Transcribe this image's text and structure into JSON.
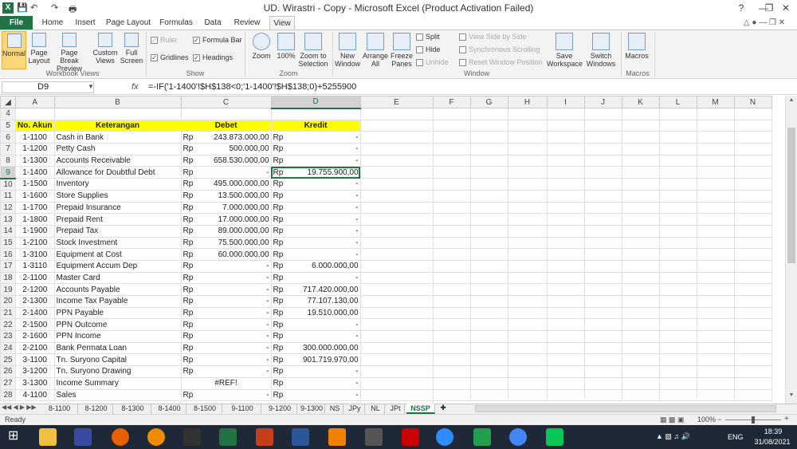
{
  "window": {
    "title": "UD. Wirastri - Copy  -  Microsoft Excel (Product Activation Failed)"
  },
  "tabs": [
    "File",
    "Home",
    "Insert",
    "Page Layout",
    "Formulas",
    "Data",
    "Review",
    "View"
  ],
  "ribbon": {
    "views": {
      "normal": "Normal",
      "page_layout": "Page Layout",
      "page_break": "Page Break Preview",
      "custom": "Custom Views",
      "full": "Full Screen",
      "label": "Workbook Views"
    },
    "show": {
      "ruler": "Ruler",
      "formula_bar": "Formula Bar",
      "gridlines": "Gridlines",
      "headings": "Headings",
      "label": "Show"
    },
    "zoom": {
      "zoom": "Zoom",
      "z100": "100%",
      "selection": "Zoom to Selection",
      "label": "Zoom"
    },
    "window": {
      "new": "New Window",
      "arrange": "Arrange All",
      "freeze": "Freeze Panes",
      "split": "Split",
      "hide": "Hide",
      "unhide": "Unhide",
      "side": "View Side by Side",
      "sync": "Synchronous Scrolling",
      "reset": "Reset Window Position",
      "save": "Save Workspace",
      "switch": "Switch Windows",
      "label": "Window"
    },
    "macros": {
      "macros": "Macros",
      "label": "Macros"
    }
  },
  "formula_bar": {
    "name_box": "D9",
    "fx": "fx",
    "formula": "=-IF('1-1400'!$H$138<0;'1-1400'!$H$138;0)+5255900"
  },
  "columns": [
    "A",
    "B",
    "C",
    "D",
    "E",
    "F",
    "G",
    "H",
    "I",
    "J",
    "K",
    "L",
    "M",
    "N"
  ],
  "header_row": {
    "num": "5",
    "a": "No. Akun",
    "b": "Keterangan",
    "c": "Debet",
    "d": "Kredit"
  },
  "rows": [
    {
      "n": "6",
      "a": "1-1100",
      "b": "Cash in Bank",
      "cc": "Rp",
      "c": "243.873.000,00",
      "dc": "Rp",
      "d": "-"
    },
    {
      "n": "7",
      "a": "1-1200",
      "b": "Petty Cash",
      "cc": "Rp",
      "c": "500.000,00",
      "dc": "Rp",
      "d": "-"
    },
    {
      "n": "8",
      "a": "1-1300",
      "b": "Accounts Receivable",
      "cc": "Rp",
      "c": "658.530.000,00",
      "dc": "Rp",
      "d": "-"
    },
    {
      "n": "9",
      "a": "1-1400",
      "b": "Allowance for Doubtful Debt",
      "cc": "Rp",
      "c": "-",
      "dc": "Rp",
      "d": "19.755.900,00"
    },
    {
      "n": "10",
      "a": "1-1500",
      "b": "Inventory",
      "cc": "Rp",
      "c": "495.000.000,00",
      "dc": "Rp",
      "d": "-"
    },
    {
      "n": "11",
      "a": "1-1600",
      "b": "Store Supplies",
      "cc": "Rp",
      "c": "13.500.000,00",
      "dc": "Rp",
      "d": "-"
    },
    {
      "n": "12",
      "a": "1-1700",
      "b": "Prepaid Insurance",
      "cc": "Rp",
      "c": "7.000.000,00",
      "dc": "Rp",
      "d": "-"
    },
    {
      "n": "13",
      "a": "1-1800",
      "b": "Prepaid Rent",
      "cc": "Rp",
      "c": "17.000.000,00",
      "dc": "Rp",
      "d": "-"
    },
    {
      "n": "14",
      "a": "1-1900",
      "b": "Prepaid Tax",
      "cc": "Rp",
      "c": "89.000.000,00",
      "dc": "Rp",
      "d": "-"
    },
    {
      "n": "15",
      "a": "1-2100",
      "b": "Stock Investment",
      "cc": "Rp",
      "c": "75.500.000,00",
      "dc": "Rp",
      "d": "-"
    },
    {
      "n": "16",
      "a": "1-3100",
      "b": "Equipment at Cost",
      "cc": "Rp",
      "c": "60.000.000,00",
      "dc": "Rp",
      "d": "-"
    },
    {
      "n": "17",
      "a": "1-3110",
      "b": "Equipment Accum Dep",
      "cc": "Rp",
      "c": "-",
      "dc": "Rp",
      "d": "6.000.000,00"
    },
    {
      "n": "18",
      "a": "2-1100",
      "b": "Master Card",
      "cc": "Rp",
      "c": "-",
      "dc": "Rp",
      "d": "-"
    },
    {
      "n": "19",
      "a": "2-1200",
      "b": "Accounts Payable",
      "cc": "Rp",
      "c": "-",
      "dc": "Rp",
      "d": "717.420.000,00"
    },
    {
      "n": "20",
      "a": "2-1300",
      "b": "Income Tax Payable",
      "cc": "Rp",
      "c": "-",
      "dc": "Rp",
      "d": "77.107.130,00"
    },
    {
      "n": "21",
      "a": "2-1400",
      "b": "PPN Payable",
      "cc": "Rp",
      "c": "-",
      "dc": "Rp",
      "d": "19.510.000,00"
    },
    {
      "n": "22",
      "a": "2-1500",
      "b": "PPN Outcome",
      "cc": "Rp",
      "c": "-",
      "dc": "Rp",
      "d": "-"
    },
    {
      "n": "23",
      "a": "2-1600",
      "b": "PPN Income",
      "cc": "Rp",
      "c": "-",
      "dc": "Rp",
      "d": "-"
    },
    {
      "n": "24",
      "a": "2-2100",
      "b": "Bank Permata Loan",
      "cc": "Rp",
      "c": "-",
      "dc": "Rp",
      "d": "300.000.000,00"
    },
    {
      "n": "25",
      "a": "3-1100",
      "b": "Tn. Suryono Capital",
      "cc": "Rp",
      "c": "-",
      "dc": "Rp",
      "d": "901.719.970,00"
    },
    {
      "n": "26",
      "a": "3-1200",
      "b": "Tn. Suryono Drawing",
      "cc": "Rp",
      "c": "-",
      "dc": "Rp",
      "d": "-"
    },
    {
      "n": "27",
      "a": "3-1300",
      "b": "Income Summary",
      "cc": "",
      "c": "#REF!",
      "dc": "Rp",
      "d": "-"
    },
    {
      "n": "28",
      "a": "4-1100",
      "b": "Sales",
      "cc": "Rp",
      "c": "-",
      "dc": "Rp",
      "d": "-"
    }
  ],
  "sheet_tabs": [
    "8-1100",
    "8-1200",
    "8-1300",
    "8-1400",
    "8-1500",
    "9-1100",
    "9-1200",
    "9-1300",
    "NS",
    "JPy",
    "NL",
    "JPt",
    "NSSP"
  ],
  "status": {
    "ready": "Ready",
    "zoom": "100%"
  },
  "tray": {
    "lang": "ENG",
    "time": "18:39",
    "date": "31/08/2021"
  }
}
